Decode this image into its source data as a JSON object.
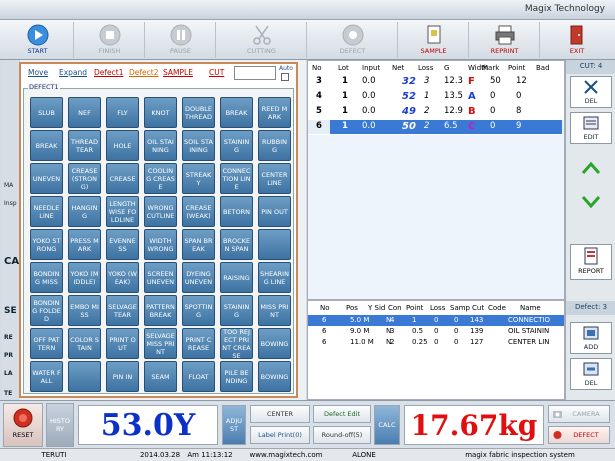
{
  "app": {
    "title": "Magix Technology"
  },
  "toolbar": {
    "start": "START",
    "finish": "FINISH",
    "pause": "PAUSE",
    "cutting": "CUTTING",
    "defect": "DEFECT",
    "sample": "SAMPLE",
    "reprint": "REPRINT",
    "exit": "EXIT"
  },
  "peek": {
    "p1": "MA",
    "p2": "Insp",
    "p3": "CA",
    "p4": "SE",
    "p5": "RE",
    "p6": "PR",
    "p7": "LA",
    "p8": "TE"
  },
  "defect_panel": {
    "tabs": [
      "Move",
      "Expand",
      "Defect1",
      "Defect2",
      "SAMPLE",
      "CUT"
    ],
    "auto_label": "Auto",
    "group_label": "DEFECT1",
    "buttons": [
      "SLUB",
      "NEF",
      "FLY",
      "KNOT",
      "DOUBLE THREAD",
      "BREAK",
      "REED MARK",
      "BREAK",
      "THREAD TEAR",
      "HOLE",
      "OIL STAINING",
      "SOIL STAINING",
      "STAINING",
      "RUBBING",
      "UNEVEN",
      "CREASE (STRONG)",
      "CREASE",
      "COOLING CREASE",
      "STREAKY",
      "CONNECTION LINE",
      "CENTER LINE",
      "NEEDLE LINE",
      "HANGING",
      "LENGTHWISE FOLDLINE",
      "WRONG CUTLINE",
      "CREASE (WEAK)",
      "BETORN",
      "PIN OUT",
      "YOKO STRONG",
      "PRESS MARK",
      "EVENNESS",
      "WIDTH WRONG",
      "SPAN BREAK",
      "BROCKEN SPAN",
      "",
      "BONDING MISS",
      "YOKO (MIDDLE)",
      "YOKO (WEAK)",
      "SCREEN UNEVEN",
      "DYEING UNEVEN",
      "RAISING",
      "SHEARING LINE",
      "BONDING FOLDED",
      "EMBO MISS",
      "SELVAGE TEAR",
      "PATTERN BREAK",
      "SPOTTING",
      "STAINING",
      "MISS PRINT",
      "OFF PATTERN",
      "COLOR STAIN",
      "PRINT OUT",
      "SELVAGE MISS PRINT",
      "PRINT CREASE",
      "TOO REJECT PRINT CREASE",
      "BOWING",
      "WATER FALL",
      "",
      "PIN IN",
      "SEAM",
      "FLOAT",
      "PILE BENDING",
      "BOWING"
    ]
  },
  "roll_table": {
    "headers": [
      "No",
      "Lot",
      "Input",
      "Net",
      "Loss",
      "G",
      "Width",
      "Mark",
      "Point",
      "Bad"
    ],
    "rows": [
      {
        "no": "3",
        "lot": "1",
        "input": "0.0",
        "net": "32",
        "loss": "3",
        "g": "12.3",
        "grade": "F",
        "width": "50",
        "point": "12",
        "bad": ""
      },
      {
        "no": "4",
        "lot": "1",
        "input": "0.0",
        "net": "52",
        "loss": "1",
        "g": "13.5",
        "grade": "A",
        "width": "0",
        "point": "0",
        "bad": ""
      },
      {
        "no": "5",
        "lot": "1",
        "input": "0.0",
        "net": "49",
        "loss": "2",
        "g": "12.9",
        "grade": "B",
        "width": "0",
        "point": "8",
        "bad": ""
      },
      {
        "no": "6",
        "lot": "1",
        "input": "0.0",
        "net": "50",
        "loss": "2",
        "g": "6.5",
        "grade": "C",
        "width": "0",
        "point": "9",
        "bad": ""
      }
    ]
  },
  "defect_table": {
    "headers": [
      "No",
      "Pos",
      "Y Sid",
      "Con",
      "Point",
      "Loss",
      "Samp",
      "Cut",
      "Code",
      "Name"
    ],
    "rows": [
      {
        "no": "6",
        "pos": "5.0 M",
        "ysid": "N",
        "con": "4",
        "point": "1",
        "loss": "0",
        "samp": "0",
        "cut": "143",
        "code": "CONNECTIO"
      },
      {
        "no": "6",
        "pos": "9.0 M",
        "ysid": "N",
        "con": "3",
        "point": "0.5",
        "loss": "0",
        "samp": "0",
        "cut": "139",
        "code": "OIL STAININ"
      },
      {
        "no": "6",
        "pos": "11.0 M",
        "ysid": "N",
        "con": "2",
        "point": "0.25",
        "loss": "0",
        "samp": "0",
        "cut": "127",
        "code": "CENTER LIN"
      }
    ]
  },
  "side": {
    "cut": "CUT: 4",
    "del": "DEL",
    "edit": "EDIT",
    "report": "REPORT",
    "defect": "Defect: 3",
    "add": "ADD",
    "del2": "DEL"
  },
  "bottom": {
    "reset": "RESET",
    "history": "HISTORY",
    "length": "53.0Y",
    "adjust": "ADJUST",
    "center": "CENTER",
    "defect_edit": "Defect Edit",
    "label_print": "Label Print(0)",
    "round_off": "Round-off(5)",
    "calc": "CALC",
    "weight": "17.67kg",
    "camera": "CAMERA",
    "defect": "DEFECT"
  },
  "status": {
    "user": "TERUTI",
    "date": "2014.03.28",
    "time": "Am 11:13:12",
    "url": "www.magixtech.com",
    "mode": "ALONE",
    "system": "magix fabric inspection system"
  }
}
